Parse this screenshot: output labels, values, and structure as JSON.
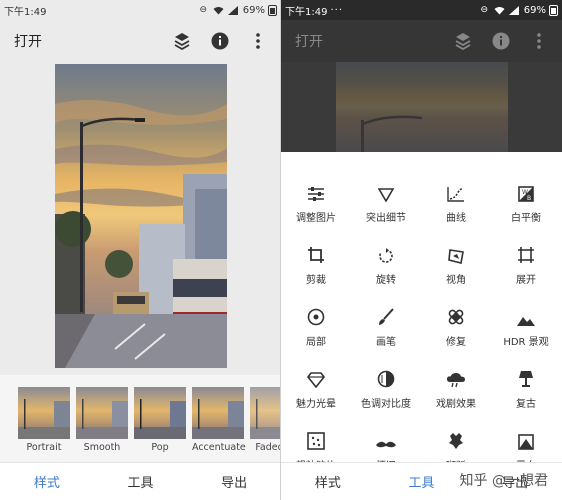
{
  "status_bar": {
    "time": "下午1:49",
    "extra": "···",
    "battery": "69%"
  },
  "top_bar": {
    "open_label": "打开"
  },
  "filters": [
    {
      "label": "Portrait"
    },
    {
      "label": "Smooth"
    },
    {
      "label": "Pop"
    },
    {
      "label": "Accentuate"
    },
    {
      "label": "Faded Gl"
    }
  ],
  "bottom_nav": {
    "styles": "样式",
    "tools": "工具",
    "export": "导出"
  },
  "tools": [
    {
      "label": "调整图片",
      "icon": "tune-icon"
    },
    {
      "label": "突出细节",
      "icon": "details-icon"
    },
    {
      "label": "曲线",
      "icon": "curves-icon"
    },
    {
      "label": "白平衡",
      "icon": "white-balance-icon"
    },
    {
      "label": "剪裁",
      "icon": "crop-icon"
    },
    {
      "label": "旋转",
      "icon": "rotate-icon"
    },
    {
      "label": "视角",
      "icon": "perspective-icon"
    },
    {
      "label": "展开",
      "icon": "expand-icon"
    },
    {
      "label": "局部",
      "icon": "selective-icon"
    },
    {
      "label": "画笔",
      "icon": "brush-icon"
    },
    {
      "label": "修复",
      "icon": "healing-icon"
    },
    {
      "label": "HDR 景观",
      "icon": "hdr-icon"
    },
    {
      "label": "魅力光晕",
      "icon": "glamour-glow-icon"
    },
    {
      "label": "色调对比度",
      "icon": "tonal-contrast-icon"
    },
    {
      "label": "戏剧效果",
      "icon": "drama-icon"
    },
    {
      "label": "复古",
      "icon": "vintage-icon"
    },
    {
      "label": "粗粒胶片",
      "icon": "grainy-film-icon"
    },
    {
      "label": "怀旧",
      "icon": "retrolux-icon"
    },
    {
      "label": "斑驳",
      "icon": "grunge-icon"
    },
    {
      "label": "黑白",
      "icon": "black-white-icon"
    }
  ],
  "watermark": {
    "text": "知乎 @一想君"
  },
  "colors": {
    "accent": "#3d7cc9",
    "panel_bg": "#ebebeb",
    "dark_bar": "#363636"
  }
}
